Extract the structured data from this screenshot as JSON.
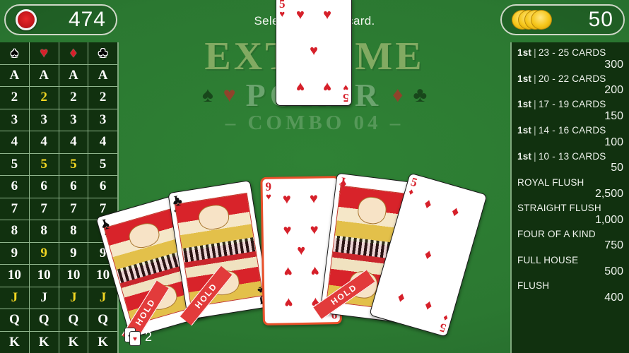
{
  "hud": {
    "left": {
      "icon": "red-chip-icon",
      "value": "474"
    },
    "right": {
      "icon": "gold-chip-stack-icon",
      "value": "50"
    }
  },
  "prompt": "Select a hand in card.",
  "logo": {
    "line1": "EXTREME",
    "line2": "POKER",
    "line3": "– COMBO 04 –",
    "suits_left": [
      "♠",
      "♥"
    ],
    "suits_right": [
      "♦",
      "♣"
    ]
  },
  "grid": {
    "headers": [
      {
        "symbol": "♠",
        "name": "spades",
        "color": "black"
      },
      {
        "symbol": "♥",
        "name": "hearts",
        "color": "red"
      },
      {
        "symbol": "♦",
        "name": "diamonds",
        "color": "red"
      },
      {
        "symbol": "♣",
        "name": "clubs",
        "color": "black"
      }
    ],
    "used_color": "#f2d723",
    "rows": [
      {
        "rank": "A",
        "cells": [
          {
            "label": "A",
            "used": false
          },
          {
            "label": "A",
            "used": false
          },
          {
            "label": "A",
            "used": false
          },
          {
            "label": "A",
            "used": false
          }
        ]
      },
      {
        "rank": "2",
        "cells": [
          {
            "label": "2",
            "used": false
          },
          {
            "label": "2",
            "used": true
          },
          {
            "label": "2",
            "used": false
          },
          {
            "label": "2",
            "used": false
          }
        ]
      },
      {
        "rank": "3",
        "cells": [
          {
            "label": "3",
            "used": false
          },
          {
            "label": "3",
            "used": false
          },
          {
            "label": "3",
            "used": false
          },
          {
            "label": "3",
            "used": false
          }
        ]
      },
      {
        "rank": "4",
        "cells": [
          {
            "label": "4",
            "used": false
          },
          {
            "label": "4",
            "used": false
          },
          {
            "label": "4",
            "used": false
          },
          {
            "label": "4",
            "used": false
          }
        ]
      },
      {
        "rank": "5",
        "cells": [
          {
            "label": "5",
            "used": false
          },
          {
            "label": "5",
            "used": true
          },
          {
            "label": "5",
            "used": true
          },
          {
            "label": "5",
            "used": false
          }
        ]
      },
      {
        "rank": "6",
        "cells": [
          {
            "label": "6",
            "used": false
          },
          {
            "label": "6",
            "used": false
          },
          {
            "label": "6",
            "used": false
          },
          {
            "label": "6",
            "used": false
          }
        ]
      },
      {
        "rank": "7",
        "cells": [
          {
            "label": "7",
            "used": false
          },
          {
            "label": "7",
            "used": false
          },
          {
            "label": "7",
            "used": false
          },
          {
            "label": "7",
            "used": false
          }
        ]
      },
      {
        "rank": "8",
        "cells": [
          {
            "label": "8",
            "used": false
          },
          {
            "label": "8",
            "used": false
          },
          {
            "label": "8",
            "used": false
          },
          {
            "label": "8",
            "used": false
          }
        ]
      },
      {
        "rank": "9",
        "cells": [
          {
            "label": "9",
            "used": false
          },
          {
            "label": "9",
            "used": true
          },
          {
            "label": "9",
            "used": false
          },
          {
            "label": "9",
            "used": false
          }
        ]
      },
      {
        "rank": "10",
        "cells": [
          {
            "label": "10",
            "used": false
          },
          {
            "label": "10",
            "used": false
          },
          {
            "label": "10",
            "used": false
          },
          {
            "label": "10",
            "used": false
          }
        ]
      },
      {
        "rank": "J",
        "cells": [
          {
            "label": "J",
            "used": true
          },
          {
            "label": "J",
            "used": false
          },
          {
            "label": "J",
            "used": true
          },
          {
            "label": "J",
            "used": true
          }
        ]
      },
      {
        "rank": "Q",
        "cells": [
          {
            "label": "Q",
            "used": false
          },
          {
            "label": "Q",
            "used": false
          },
          {
            "label": "Q",
            "used": false
          },
          {
            "label": "Q",
            "used": false
          }
        ]
      },
      {
        "rank": "K",
        "cells": [
          {
            "label": "K",
            "used": false
          },
          {
            "label": "K",
            "used": false
          },
          {
            "label": "K",
            "used": false
          },
          {
            "label": "K",
            "used": false
          }
        ]
      }
    ]
  },
  "paytable": [
    {
      "rank": "1st",
      "sep": "|",
      "desc": "23 - 25  CARDS",
      "amount": "300"
    },
    {
      "rank": "1st",
      "sep": "|",
      "desc": "20 - 22  CARDS",
      "amount": "200"
    },
    {
      "rank": "1st",
      "sep": "|",
      "desc": "17 - 19  CARDS",
      "amount": "150"
    },
    {
      "rank": "1st",
      "sep": "|",
      "desc": "14 - 16  CARDS",
      "amount": "100"
    },
    {
      "rank": "1st",
      "sep": "|",
      "desc": "10 - 13  CARDS",
      "amount": "50"
    },
    {
      "rank": "",
      "sep": "",
      "desc": "ROYAL FLUSH",
      "amount": "2,500"
    },
    {
      "rank": "",
      "sep": "",
      "desc": "STRAIGHT FLUSH",
      "amount": "1,000"
    },
    {
      "rank": "",
      "sep": "",
      "desc": "FOUR OF A KIND",
      "amount": "750"
    },
    {
      "rank": "",
      "sep": "",
      "desc": "FULL HOUSE",
      "amount": "500"
    },
    {
      "rank": "",
      "sep": "",
      "desc": "FLUSH",
      "amount": "400"
    }
  ],
  "drawn_card": {
    "rank": "5",
    "suit": "♥",
    "suit_name": "hearts",
    "color": "red"
  },
  "hand": [
    {
      "rank": "J",
      "suit": "♠",
      "suit_name": "spades",
      "color": "black",
      "face": true,
      "hold": true,
      "hold_label": "HOLD",
      "selected": false
    },
    {
      "rank": "J",
      "suit": "♣",
      "suit_name": "clubs",
      "color": "black",
      "face": true,
      "hold": true,
      "hold_label": "HOLD",
      "selected": false
    },
    {
      "rank": "9",
      "suit": "♥",
      "suit_name": "hearts",
      "color": "red",
      "face": false,
      "hold": false,
      "hold_label": "",
      "selected": true
    },
    {
      "rank": "J",
      "suit": "♦",
      "suit_name": "diamonds",
      "color": "red",
      "face": true,
      "hold": true,
      "hold_label": "HOLD",
      "selected": false
    },
    {
      "rank": "5",
      "suit": "♦",
      "suit_name": "diamonds",
      "color": "red",
      "face": false,
      "hold": false,
      "hold_label": "",
      "selected": false
    }
  ],
  "deck_counter": {
    "value": "2",
    "icon": "card-stack-icon"
  },
  "colors": {
    "table_green": "#2b7831",
    "panel_dark": "#11310f",
    "panel_border": "#7fa87c",
    "highlight_yellow": "#f2d723",
    "select_orange": "#e8502a",
    "card_red": "#d6202a"
  }
}
